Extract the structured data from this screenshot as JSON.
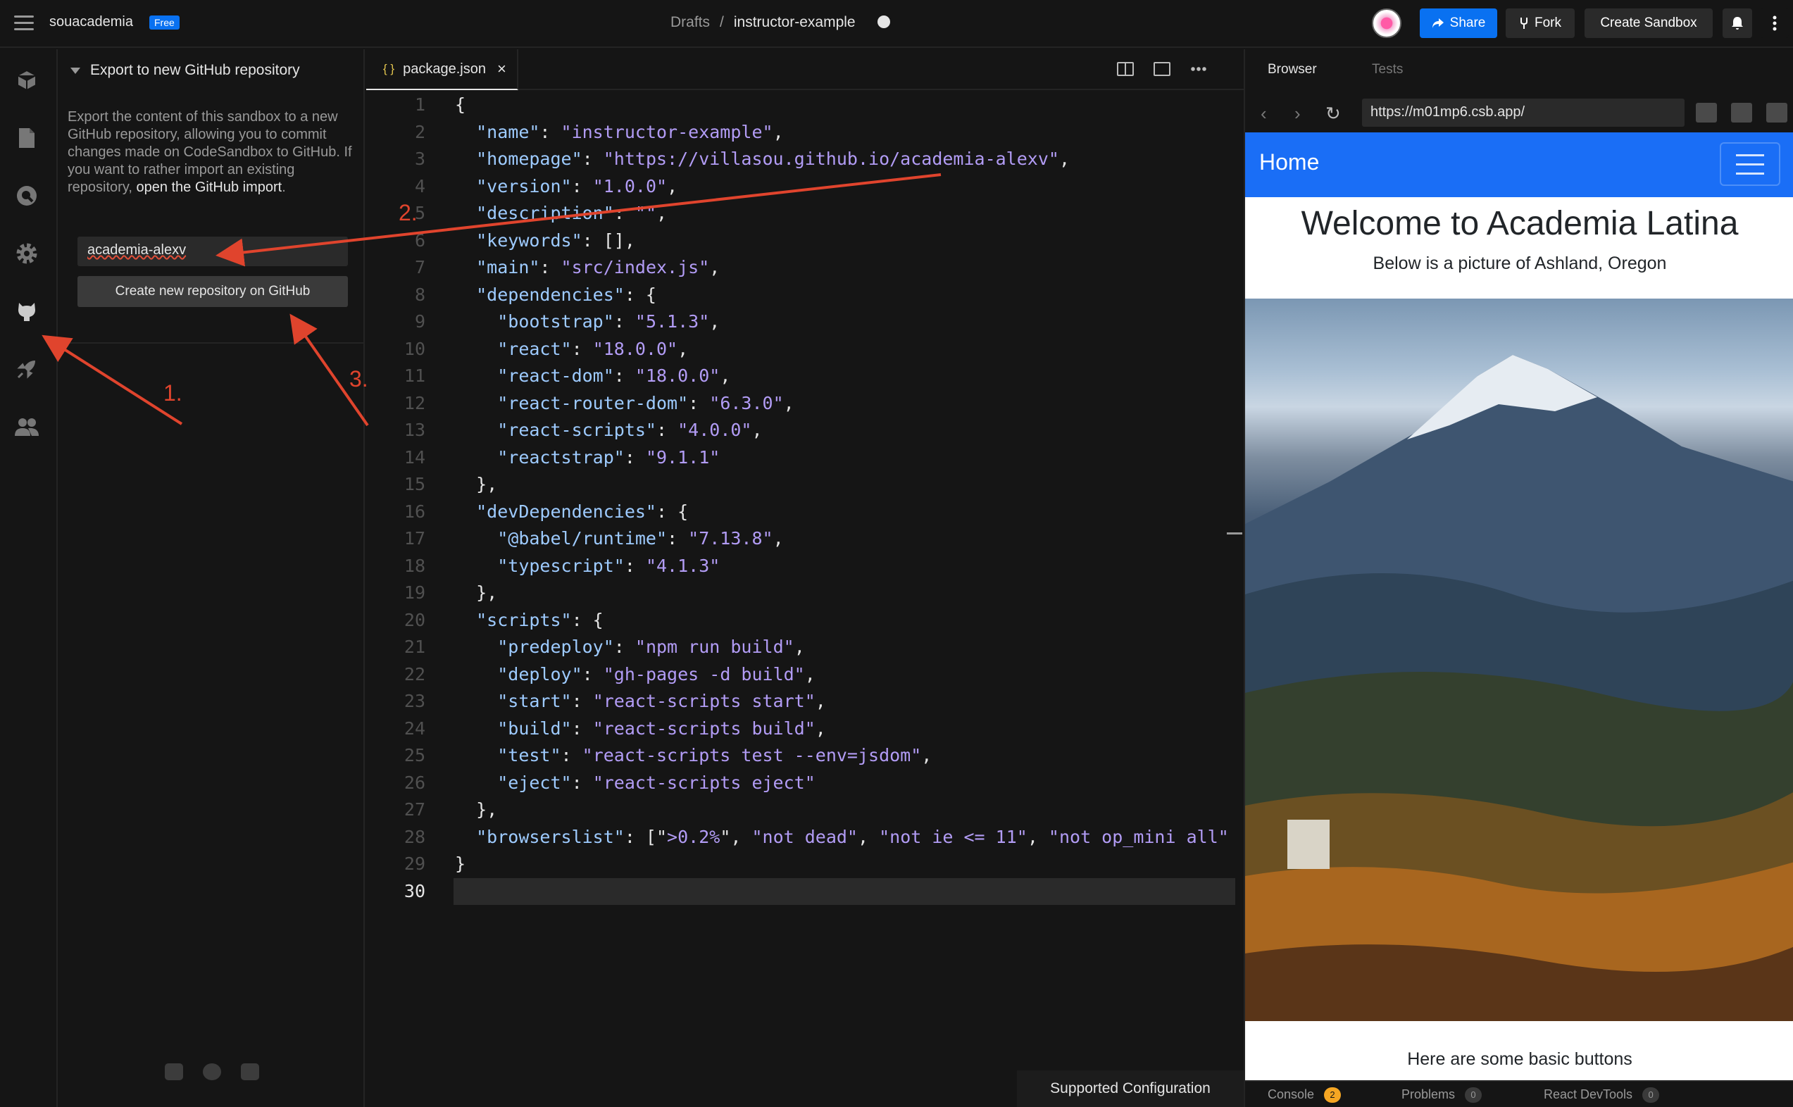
{
  "topbar": {
    "team": "souacademia",
    "badge": "Free",
    "crumb_folder": "Drafts",
    "crumb_sep": "/",
    "sandbox_name": "instructor-example",
    "share": "Share",
    "fork": "Fork",
    "create_sandbox": "Create Sandbox"
  },
  "sidebar": {
    "title": "Export to new GitHub repository",
    "description": "Export the content of this sandbox to a new GitHub repository, allowing you to commit changes made on CodeSandbox to GitHub. If you want to rather import an existing repository,",
    "link": "open the GitHub import",
    "period": ".",
    "repo_name": "academia-alexv",
    "create_button": "Create new repository on GitHub"
  },
  "editor": {
    "tab": "package.json",
    "tab_icon": "{ }",
    "close": "×",
    "status": "Supported Configuration"
  },
  "code_lines": [
    [
      [
        "p",
        "{"
      ]
    ],
    [
      [
        "p",
        "  "
      ],
      [
        "k",
        "\"name\""
      ],
      [
        "p",
        ": "
      ],
      [
        "s",
        "\"instructor-example\""
      ],
      [
        "p",
        ","
      ]
    ],
    [
      [
        "p",
        "  "
      ],
      [
        "k",
        "\"homepage\""
      ],
      [
        "p",
        ": "
      ],
      [
        "s",
        "\"https://villasou.github.io/academia-alexv\""
      ],
      [
        "p",
        ","
      ]
    ],
    [
      [
        "p",
        "  "
      ],
      [
        "k",
        "\"version\""
      ],
      [
        "p",
        ": "
      ],
      [
        "s",
        "\"1.0.0\""
      ],
      [
        "p",
        ","
      ]
    ],
    [
      [
        "p",
        "  "
      ],
      [
        "k",
        "\"description\""
      ],
      [
        "p",
        ": "
      ],
      [
        "s",
        "\"\""
      ],
      [
        "p",
        ","
      ]
    ],
    [
      [
        "p",
        "  "
      ],
      [
        "k",
        "\"keywords\""
      ],
      [
        "p",
        ": [],"
      ]
    ],
    [
      [
        "p",
        "  "
      ],
      [
        "k",
        "\"main\""
      ],
      [
        "p",
        ": "
      ],
      [
        "s",
        "\"src/index.js\""
      ],
      [
        "p",
        ","
      ]
    ],
    [
      [
        "p",
        "  "
      ],
      [
        "k",
        "\"dependencies\""
      ],
      [
        "p",
        ": {"
      ]
    ],
    [
      [
        "p",
        "    "
      ],
      [
        "k",
        "\"bootstrap\""
      ],
      [
        "p",
        ": "
      ],
      [
        "s",
        "\"5.1.3\""
      ],
      [
        "p",
        ","
      ]
    ],
    [
      [
        "p",
        "    "
      ],
      [
        "k",
        "\"react\""
      ],
      [
        "p",
        ": "
      ],
      [
        "s",
        "\"18.0.0\""
      ],
      [
        "p",
        ","
      ]
    ],
    [
      [
        "p",
        "    "
      ],
      [
        "k",
        "\"react-dom\""
      ],
      [
        "p",
        ": "
      ],
      [
        "s",
        "\"18.0.0\""
      ],
      [
        "p",
        ","
      ]
    ],
    [
      [
        "p",
        "    "
      ],
      [
        "k",
        "\"react-router-dom\""
      ],
      [
        "p",
        ": "
      ],
      [
        "s",
        "\"6.3.0\""
      ],
      [
        "p",
        ","
      ]
    ],
    [
      [
        "p",
        "    "
      ],
      [
        "k",
        "\"react-scripts\""
      ],
      [
        "p",
        ": "
      ],
      [
        "s",
        "\"4.0.0\""
      ],
      [
        "p",
        ","
      ]
    ],
    [
      [
        "p",
        "    "
      ],
      [
        "k",
        "\"reactstrap\""
      ],
      [
        "p",
        ": "
      ],
      [
        "s",
        "\"9.1.1\""
      ]
    ],
    [
      [
        "p",
        "  },"
      ]
    ],
    [
      [
        "p",
        "  "
      ],
      [
        "k",
        "\"devDependencies\""
      ],
      [
        "p",
        ": {"
      ]
    ],
    [
      [
        "p",
        "    "
      ],
      [
        "k",
        "\"@babel/runtime\""
      ],
      [
        "p",
        ": "
      ],
      [
        "s",
        "\"7.13.8\""
      ],
      [
        "p",
        ","
      ]
    ],
    [
      [
        "p",
        "    "
      ],
      [
        "k",
        "\"typescript\""
      ],
      [
        "p",
        ": "
      ],
      [
        "s",
        "\"4.1.3\""
      ]
    ],
    [
      [
        "p",
        "  },"
      ]
    ],
    [
      [
        "p",
        "  "
      ],
      [
        "k",
        "\"scripts\""
      ],
      [
        "p",
        ": {"
      ]
    ],
    [
      [
        "p",
        "    "
      ],
      [
        "k",
        "\"predeploy\""
      ],
      [
        "p",
        ": "
      ],
      [
        "s",
        "\"npm run build\""
      ],
      [
        "p",
        ","
      ]
    ],
    [
      [
        "p",
        "    "
      ],
      [
        "k",
        "\"deploy\""
      ],
      [
        "p",
        ": "
      ],
      [
        "s",
        "\"gh-pages -d build\""
      ],
      [
        "p",
        ","
      ]
    ],
    [
      [
        "p",
        "    "
      ],
      [
        "k",
        "\"start\""
      ],
      [
        "p",
        ": "
      ],
      [
        "s",
        "\"react-scripts start\""
      ],
      [
        "p",
        ","
      ]
    ],
    [
      [
        "p",
        "    "
      ],
      [
        "k",
        "\"build\""
      ],
      [
        "p",
        ": "
      ],
      [
        "s",
        "\"react-scripts build\""
      ],
      [
        "p",
        ","
      ]
    ],
    [
      [
        "p",
        "    "
      ],
      [
        "k",
        "\"test\""
      ],
      [
        "p",
        ": "
      ],
      [
        "s",
        "\"react-scripts test --env=jsdom\""
      ],
      [
        "p",
        ","
      ]
    ],
    [
      [
        "p",
        "    "
      ],
      [
        "k",
        "\"eject\""
      ],
      [
        "p",
        ": "
      ],
      [
        "s",
        "\"react-scripts eject\""
      ]
    ],
    [
      [
        "p",
        "  },"
      ]
    ],
    [
      [
        "p",
        "  "
      ],
      [
        "k",
        "\"browserslist\""
      ],
      [
        "p",
        ": [\""
      ],
      [
        "s",
        ">0.2%"
      ],
      [
        "p",
        "\", "
      ],
      [
        "s",
        "\"not dead\""
      ],
      [
        "p",
        ", "
      ],
      [
        "s",
        "\"not ie <= 11\""
      ],
      [
        "p",
        ", "
      ],
      [
        "s",
        "\"not op_mini all\""
      ]
    ],
    [
      [
        "p",
        "}"
      ]
    ],
    [
      [
        "p",
        ""
      ]
    ]
  ],
  "browser": {
    "tab_browser": "Browser",
    "tab_tests": "Tests",
    "url": "https://m01mp6.csb.app/",
    "nav_brand": "Home",
    "heading": "Welcome to Academia Latina",
    "subheading": "Below is a picture of Ashland, Oregon",
    "buttons_text": "Here are some basic buttons",
    "console": "Console",
    "console_count": "2",
    "problems": "Problems",
    "problems_count": "0",
    "devtools": "React DevTools",
    "devtools_count": "0"
  },
  "annotations": {
    "label_1": "1.",
    "label_2": "2.",
    "label_3": "3.",
    "color": "#e0442d"
  },
  "colors": {
    "accent": "#0971f1",
    "key": "#9ecbff",
    "string": "#b29cf5",
    "navbar": "#1a6ef6"
  }
}
